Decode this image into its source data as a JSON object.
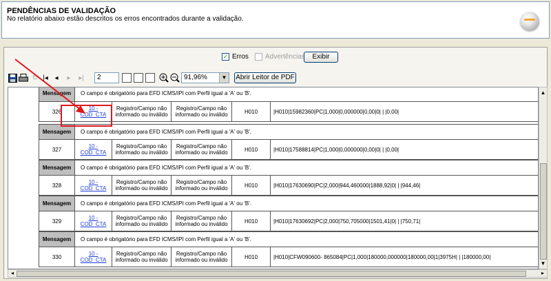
{
  "header": {
    "title": "PENDÊNCIAS DE VALIDAÇÃO",
    "subtitle": "No relatório abaixo estão descritos os erros encontrados durante a validação."
  },
  "filters": {
    "erros_label": "Erros",
    "erros_checked": true,
    "advertencias_label": "Advertências",
    "advertencias_checked": false,
    "exibir_label": "Exibir"
  },
  "toolbar": {
    "page_number": "2",
    "zoom": "91,96%",
    "pdf_button_label": "Abrir Leitor de PDF"
  },
  "report": {
    "message_label": "Mensagem",
    "message_text": "O campo é obrigatório para EFD ICMS/IPI com Perfil igual a 'A' ou 'B'.",
    "rows": [
      {
        "num": "326",
        "field": "10 - COD_CTA",
        "reg1": "Registro/Campo não informado ou inválido",
        "reg2": "Registro/Campo não informado ou inválido",
        "h": "H010",
        "line": "|H010|15982360|PC|1,000|0,000000|0,00|0| | |0,00|"
      },
      {
        "num": "327",
        "field": "10 - COD_CTA",
        "reg1": "Registro/Campo não informado ou inválido",
        "reg2": "Registro/Campo não informado ou inválido",
        "h": "H010",
        "line": "|H010|17588814|PC|1,000|0,000000|0,00|0| | |0,00|"
      },
      {
        "num": "328",
        "field": "10 - COD_CTA",
        "reg1": "Registro/Campo não informado ou inválido",
        "reg2": "Registro/Campo não informado ou inválido",
        "h": "H010",
        "line": "|H010|17630690|PC|2,000|944,460000|1888,92|0| | |944,46|"
      },
      {
        "num": "329",
        "field": "10 - COD_CTA",
        "reg1": "Registro/Campo não informado ou inválido",
        "reg2": "Registro/Campo não informado ou inválido",
        "h": "H010",
        "line": "|H010|17630692|PC|2,000|750,705000|1501,41|0| | |750,71|"
      },
      {
        "num": "330",
        "field": "10 - COD_CTA",
        "reg1": "Registro/Campo não informado ou inválido",
        "reg2": "Registro/Campo não informado ou inválido",
        "h": "H010",
        "line": "|H010|CFW090600- 865084|PC|1,000|180000,000000|180000,00|1|3975H| | |180000,00|"
      }
    ]
  },
  "colors": {
    "annotation": "#e0161b",
    "link": "#1e3ed6"
  }
}
